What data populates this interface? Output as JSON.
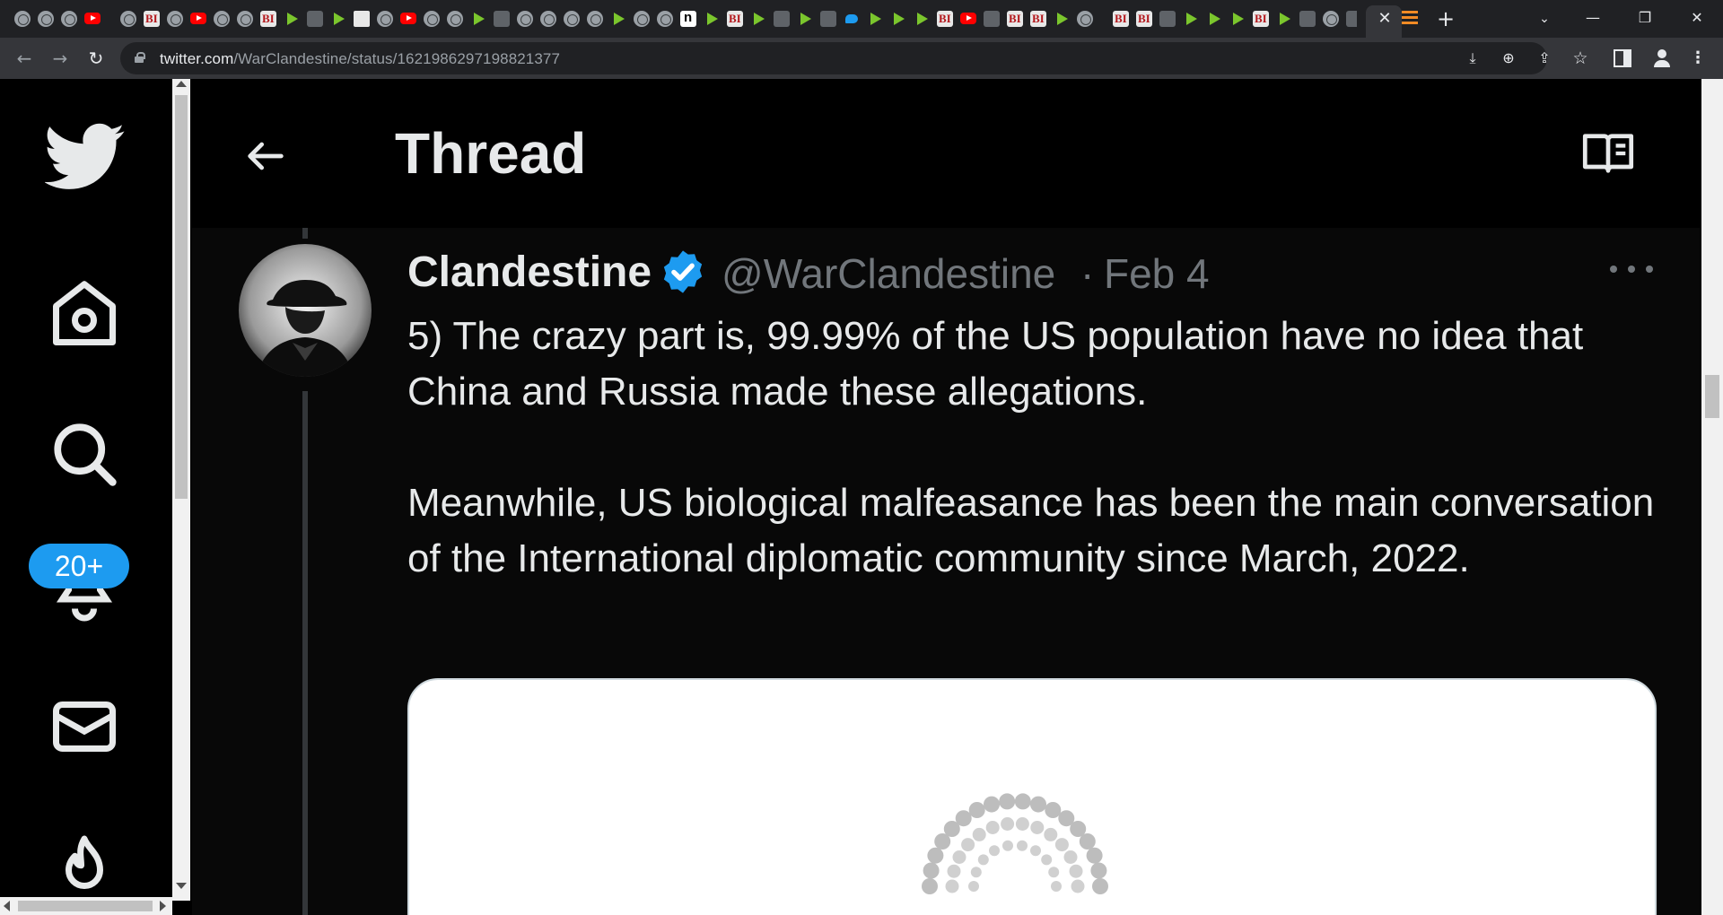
{
  "browser": {
    "tab_favicons": [
      "globe-icon",
      "pinwheel-icon",
      "globe-icon",
      "youtube-icon",
      "sep",
      "globe-icon",
      "bi-icon",
      "globe-icon",
      "youtube-icon",
      "globe-icon",
      "globe-icon",
      "bi-icon",
      "play-icon",
      "moon-icon",
      "play-icon",
      "sq-icon",
      "globe-icon",
      "youtube-icon",
      "globe-icon",
      "globe-icon",
      "play-icon",
      "search-icon",
      "globe-icon",
      "globe-icon",
      "globe-icon",
      "globe-icon",
      "play-icon",
      "globe-icon",
      "globe-icon",
      "n-icon",
      "play-icon",
      "bi-icon",
      "play-icon",
      "moon-icon",
      "play-icon",
      "search-icon",
      "twitter-icon",
      "play-icon",
      "play-icon",
      "play-icon",
      "bi-icon",
      "youtube-icon",
      "dark-icon",
      "bi-icon",
      "bi-icon",
      "play-icon",
      "globe-icon",
      "sep",
      "bi-icon",
      "bi-icon",
      "dark-icon",
      "play-icon",
      "play-icon",
      "play-icon",
      "bi-icon",
      "play-icon",
      "moon-icon",
      "globe-icon",
      "search-icon",
      "g-icon",
      "purple-icon"
    ],
    "active_tab_close": "✕",
    "new_tab": "+",
    "tab_search": "⌄",
    "window_controls": {
      "minimize": "—",
      "maximize": "❐",
      "close": "✕"
    },
    "nav": {
      "back": "←",
      "forward": "→",
      "reload": "↻"
    },
    "url_host": "twitter.com",
    "url_path": "/WarClandestine/status/1621986297198821377",
    "omnibox_icons": {
      "install": "⤓",
      "zoom": "⊕",
      "share": "⇪",
      "bookmark": "☆"
    },
    "menu": "⋮"
  },
  "sidebar": {
    "items": [
      {
        "name": "twitter-logo"
      },
      {
        "name": "home-icon"
      },
      {
        "name": "explore-icon"
      },
      {
        "name": "notifications-icon"
      },
      {
        "name": "messages-icon"
      },
      {
        "name": "topics-icon"
      }
    ],
    "notification_badge": "20+"
  },
  "thread": {
    "title": "Thread",
    "tweet": {
      "display_name": "Clandestine",
      "handle": "@WarClandestine",
      "separator": "·",
      "date": "Feb 4",
      "paragraph_1": "5) The crazy part is, 99.99% of the US population have no idea that China and Russia made these allegations.",
      "paragraph_2": "Meanwhile, US biological malfeasance has been the main conversation of the International diplomatic community since March, 2022."
    }
  },
  "colors": {
    "accent": "#1d9bf0",
    "text_primary": "#e7e9ea",
    "text_secondary": "#71767b",
    "browser_frame": "#202124",
    "toolbar": "#35363a"
  }
}
